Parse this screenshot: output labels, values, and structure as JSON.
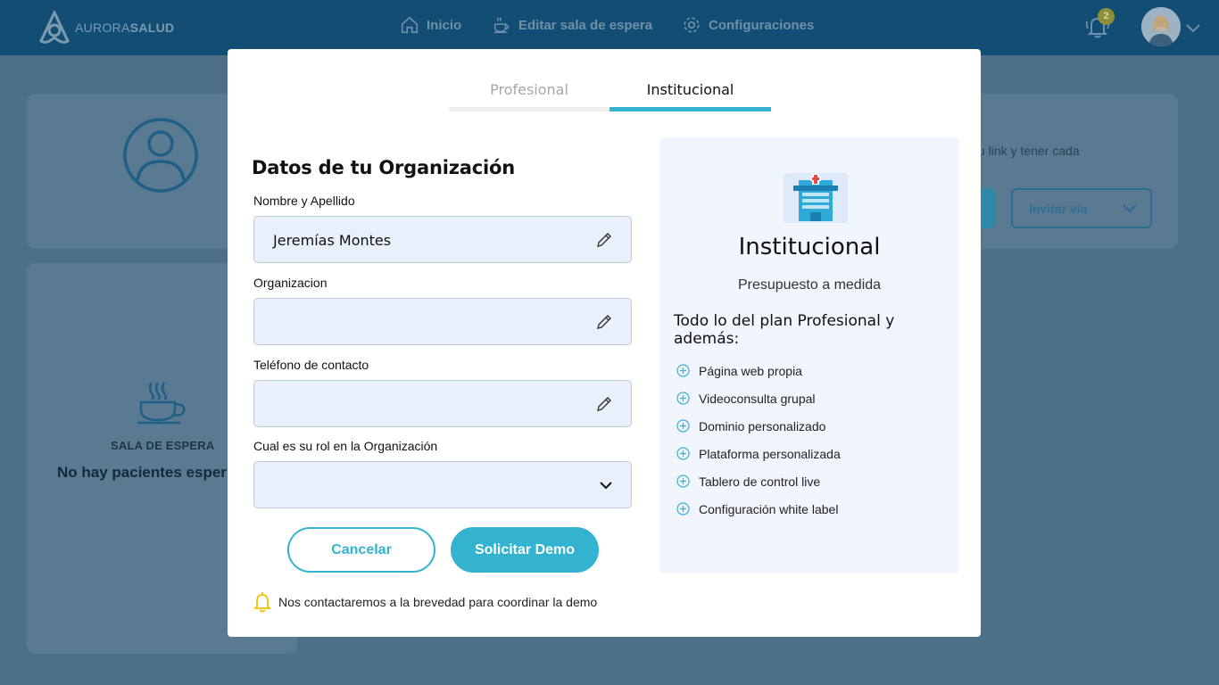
{
  "app": {
    "brand_light": "AURORA",
    "brand_bold": "SALUD",
    "nav": [
      {
        "label": "Inicio",
        "icon": "home-icon"
      },
      {
        "label": "Editar sala de espera",
        "icon": "coffee-icon"
      },
      {
        "label": "Configuraciones",
        "icon": "gear-icon"
      }
    ],
    "notifications_count": "2"
  },
  "background": {
    "sala_title": "SALA DE ESPERA",
    "sala_empty": "No hay pacientes esper",
    "link_text": "u link y tener cada",
    "invitar_label": "Invitar vía"
  },
  "modal": {
    "tabs": [
      {
        "label": "Profesional",
        "active": false
      },
      {
        "label": "Institucional",
        "active": true
      }
    ],
    "form": {
      "title": "Datos de tu Organización",
      "fields": [
        {
          "label": "Nombre y Apellido",
          "value": "Jeremías Montes",
          "type": "text"
        },
        {
          "label": "Organizacion",
          "value": "",
          "type": "text"
        },
        {
          "label": "Teléfono de contacto",
          "value": "",
          "type": "text"
        },
        {
          "label": "Cual es su rol en la Organización",
          "value": "",
          "type": "select"
        }
      ],
      "cancel_label": "Cancelar",
      "submit_label": "Solicitar Demo",
      "note": "Nos contactaremos a la brevedad para coordinar la demo"
    },
    "plan": {
      "name": "Institucional",
      "price": "Presupuesto a medida",
      "subtitle": "Todo lo del plan Profesional y además:",
      "features": [
        "Página web propia",
        "Videoconsulta grupal",
        "Dominio personalizado",
        "Plataforma personalizada",
        " Tablero de control live",
        "Configuración white label"
      ]
    }
  },
  "colors": {
    "accent": "#33b3d0",
    "topbar": "#124e74",
    "field_bg": "#e9effb",
    "plan_bg": "#f1f5fd",
    "bell_note": "#f2c200"
  }
}
